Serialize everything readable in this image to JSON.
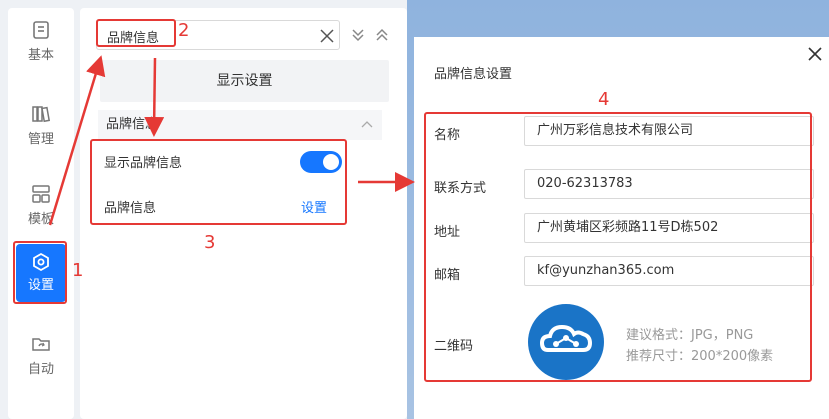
{
  "nav": {
    "items": [
      {
        "label": "基本",
        "icon": "document-icon"
      },
      {
        "label": "管理",
        "icon": "books-icon"
      },
      {
        "label": "模板",
        "icon": "template-icon"
      },
      {
        "label": "设置",
        "icon": "settings-icon",
        "active": true
      },
      {
        "label": "自动",
        "icon": "folder-sync-icon"
      }
    ]
  },
  "panel": {
    "search_value": "品牌信息",
    "display_settings_label": "显示设置",
    "section_title": "品牌信息",
    "show_brand_label": "显示品牌信息",
    "show_brand_enabled": true,
    "brand_info_label": "品牌信息",
    "brand_info_action": "设置"
  },
  "dialog": {
    "title": "品牌信息设置",
    "fields": {
      "name": {
        "label": "名称",
        "value": "广州万彩信息技术有限公司"
      },
      "contact": {
        "label": "联系方式",
        "value": "020-62313783"
      },
      "address": {
        "label": "地址",
        "value": "广州黄埔区彩频路11号D栋502"
      },
      "email": {
        "label": "邮箱",
        "value": "kf@yunzhan365.com"
      },
      "qrcode": {
        "label": "二维码"
      }
    },
    "hint_format": "建议格式：JPG，PNG",
    "hint_size": "推荐尺寸：200*200像素"
  },
  "annotations": {
    "n1": "1",
    "n2": "2",
    "n3": "3",
    "n4": "4"
  },
  "colors": {
    "accent": "#1677ff",
    "annotation": "#e53935",
    "logo": "#1a74c7"
  }
}
